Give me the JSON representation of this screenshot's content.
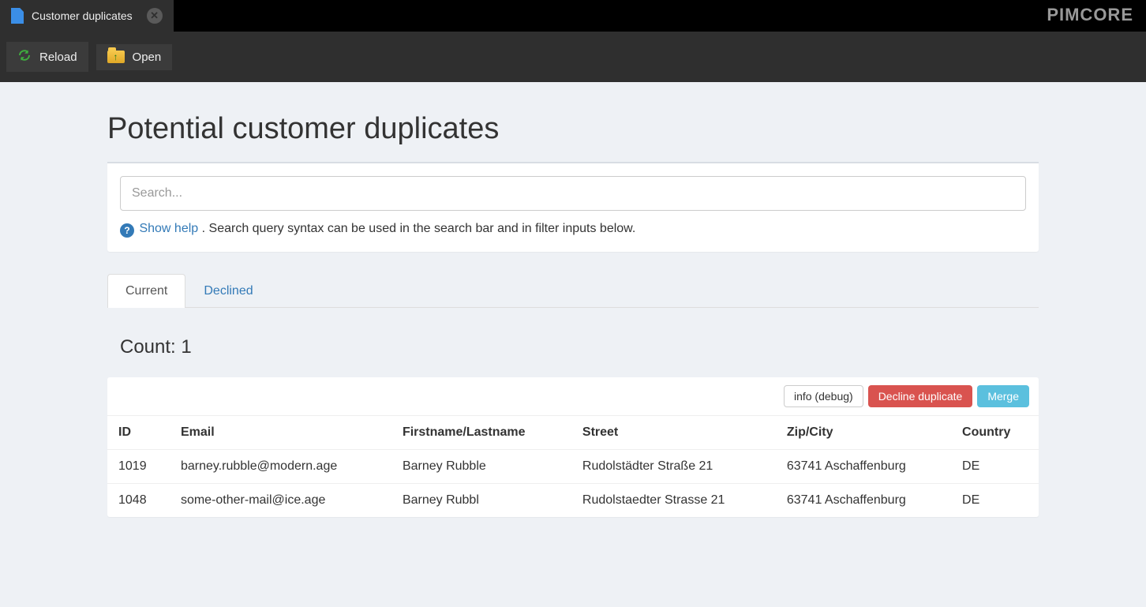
{
  "brand": "PIMCORE",
  "tab": {
    "title": "Customer duplicates"
  },
  "toolbar": {
    "reload_label": "Reload",
    "open_label": "Open"
  },
  "page": {
    "title": "Potential customer duplicates",
    "search_placeholder": "Search...",
    "help_link": "Show help",
    "help_text": ". Search query syntax can be used in the search bar and in filter inputs below."
  },
  "tabs": {
    "current": "Current",
    "declined": "Declined",
    "active": 0
  },
  "count_label": "Count: 1",
  "actions": {
    "info": "info (debug)",
    "decline": "Decline duplicate",
    "merge": "Merge"
  },
  "table": {
    "headers": [
      "ID",
      "Email",
      "Firstname/Lastname",
      "Street",
      "Zip/City",
      "Country"
    ],
    "rows": [
      [
        "1019",
        "barney.rubble@modern.age",
        "Barney Rubble",
        "Rudolstädter Straße 21",
        "63741 Aschaffenburg",
        "DE"
      ],
      [
        "1048",
        "some-other-mail@ice.age",
        "Barney Rubbl",
        "Rudolstaedter Strasse 21",
        "63741 Aschaffenburg",
        "DE"
      ]
    ]
  }
}
